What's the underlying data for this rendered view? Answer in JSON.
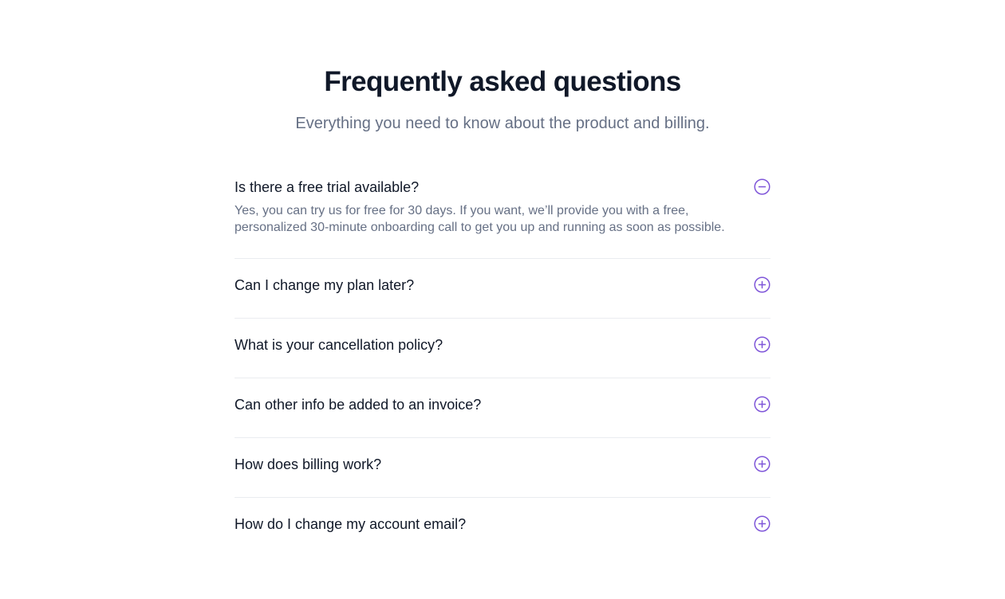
{
  "header": {
    "title": "Frequently asked questions",
    "subtitle": "Everything you need to know about the product and billing."
  },
  "faqs": [
    {
      "question": "Is there a free trial available?",
      "answer": "Yes, you can try us for free for 30 days. If you want, we’ll provide you with a free, personalized 30-minute onboarding call to get you up and running as soon as possible.",
      "expanded": true,
      "icon": "minus-circle-icon"
    },
    {
      "question": "Can I change my plan later?",
      "expanded": false,
      "icon": "plus-circle-icon"
    },
    {
      "question": "What is your cancellation policy?",
      "expanded": false,
      "icon": "plus-circle-icon"
    },
    {
      "question": "Can other info be added to an invoice?",
      "expanded": false,
      "icon": "plus-circle-icon"
    },
    {
      "question": "How does billing work?",
      "expanded": false,
      "icon": "plus-circle-icon"
    },
    {
      "question": "How do I change my account email?",
      "expanded": false,
      "icon": "plus-circle-icon"
    }
  ],
  "colors": {
    "heading": "#101828",
    "muted": "#667085",
    "accent": "#7f56d9",
    "divider": "#eaecf0"
  }
}
